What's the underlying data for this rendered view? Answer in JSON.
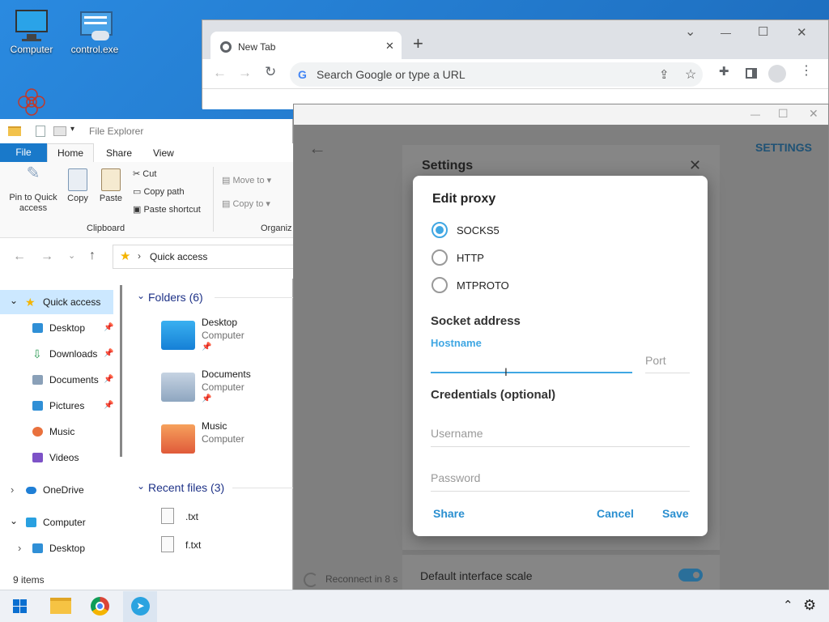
{
  "desktop": {
    "icons": [
      {
        "label": "Computer",
        "icon": "monitor-icon"
      },
      {
        "label": "control.exe",
        "icon": "control-panel-icon"
      },
      {
        "label": "",
        "icon": "app-flower-icon"
      }
    ]
  },
  "chrome": {
    "tab_title": "New Tab",
    "tab_close": "✕",
    "new_tab": "+",
    "omnibox_placeholder": "Search Google or type a URL",
    "window_controls": [
      "⌄",
      "—",
      "☐",
      "✕"
    ]
  },
  "telegram": {
    "header_right": "SETTINGS",
    "back": "←",
    "window_controls": [
      "—",
      "☐",
      "✕"
    ],
    "settings_title": "Settings",
    "settings_close": "✕",
    "reconnect_text": "Reconnect in 8 s",
    "interface_scale_label": "Default interface scale",
    "interface_scale_on": true,
    "edit_proxy": {
      "title": "Edit proxy",
      "types": [
        {
          "label": "SOCKS5",
          "selected": true
        },
        {
          "label": "HTTP",
          "selected": false
        },
        {
          "label": "MTPROTO",
          "selected": false
        }
      ],
      "socket_heading": "Socket address",
      "hostname_label": "Hostname",
      "hostname_value": "",
      "port_placeholder": "Port",
      "credentials_heading": "Credentials (optional)",
      "username_placeholder": "Username",
      "password_placeholder": "Password",
      "share_label": "Share",
      "cancel_label": "Cancel",
      "save_label": "Save"
    },
    "accent_color": "#40a7e3"
  },
  "explorer": {
    "title": "File Explorer",
    "ribbon_tabs": [
      "File",
      "Home",
      "Share",
      "View"
    ],
    "active_tab": "Home",
    "clipboard": {
      "pin_label": "Pin to Quick access",
      "copy_label": "Copy",
      "paste_label": "Paste",
      "cut_label": "Cut",
      "copy_path_label": "Copy path",
      "paste_shortcut_label": "Paste shortcut",
      "group_label": "Clipboard"
    },
    "organize": {
      "move_to_label": "Move to",
      "copy_to_label": "Copy to",
      "group_label": "Organiz"
    },
    "address_path": "Quick access",
    "tree": [
      {
        "label": "Quick access",
        "icon": "star-icon",
        "pinned": false,
        "selected": true,
        "expand": "⌄"
      },
      {
        "label": "Desktop",
        "icon": "desktop-folder-icon",
        "pinned": true
      },
      {
        "label": "Downloads",
        "icon": "download-icon",
        "pinned": true
      },
      {
        "label": "Documents",
        "icon": "documents-icon",
        "pinned": true
      },
      {
        "label": "Pictures",
        "icon": "pictures-icon",
        "pinned": true
      },
      {
        "label": "Music",
        "icon": "music-icon",
        "pinned": false
      },
      {
        "label": "Videos",
        "icon": "videos-icon",
        "pinned": false
      },
      {
        "label": "OneDrive",
        "icon": "cloud-icon",
        "pinned": false,
        "expand": "›"
      },
      {
        "label": "Computer",
        "icon": "computer-icon",
        "pinned": false,
        "expand": "⌄"
      },
      {
        "label": "Desktop",
        "icon": "desktop-folder-icon",
        "pinned": false,
        "expand": "›"
      }
    ],
    "folders_heading": "Folders (6)",
    "folders": [
      {
        "name": "Desktop",
        "location": "Computer",
        "pinned": true
      },
      {
        "name": "Documents",
        "location": "Computer",
        "pinned": true
      },
      {
        "name": "Music",
        "location": "Computer",
        "pinned": false
      }
    ],
    "recent_heading": "Recent files (3)",
    "recent": [
      {
        "name": ".txt"
      },
      {
        "name": "f.txt"
      }
    ],
    "status": "9 items"
  }
}
